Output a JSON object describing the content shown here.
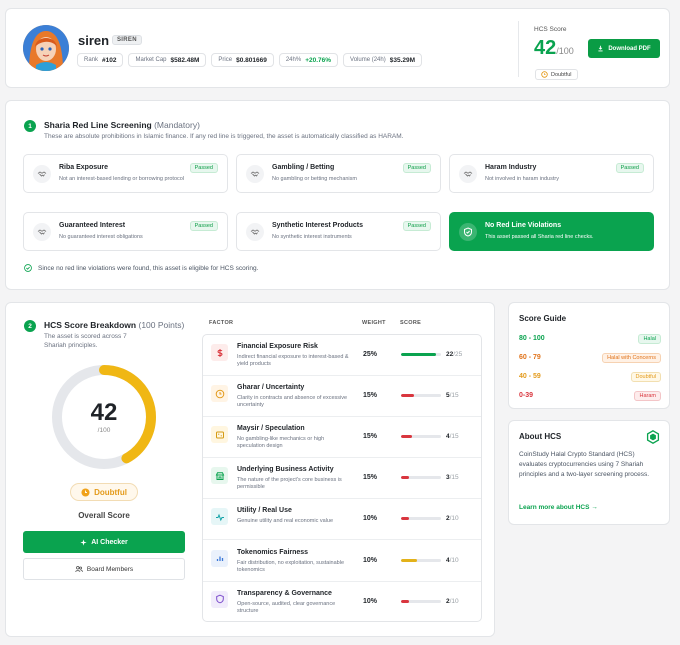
{
  "header": {
    "coin_name": "siren",
    "symbol": "SIREN",
    "stats": [
      {
        "label": "Rank",
        "value": "#102",
        "positive": false
      },
      {
        "label": "Market Cap",
        "value": "$582.48M",
        "positive": false
      },
      {
        "label": "Price",
        "value": "$0.801669",
        "positive": false
      },
      {
        "label": "24h%",
        "value": "+20.76%",
        "positive": true
      },
      {
        "label": "Volume (24h)",
        "value": "$35.29M",
        "positive": false
      }
    ],
    "hcs_label": "HCS Score",
    "hcs_score": "42",
    "hcs_max": "/100",
    "hcs_status": "Doubtful",
    "download_label": "Download PDF"
  },
  "red_line": {
    "number": "1",
    "title": "Sharia Red Line Screening",
    "title_suffix": "(Mandatory)",
    "subtitle": "These are absolute prohibitions in Islamic finance. If any red line is triggered, the asset is automatically classified as HARAM.",
    "items": [
      {
        "title": "Riba Exposure",
        "desc": "Not an interest-based lending or borrowing protocol",
        "status": "Passed"
      },
      {
        "title": "Gambling / Betting",
        "desc": "No gambling or betting mechanism",
        "status": "Passed"
      },
      {
        "title": "Haram Industry",
        "desc": "Not involved in haram industry",
        "status": "Passed"
      },
      {
        "title": "Guaranteed Interest",
        "desc": "No guaranteed interest obligations",
        "status": "Passed"
      },
      {
        "title": "Synthetic Interest Products",
        "desc": "No synthetic interest instruments",
        "status": "Passed"
      }
    ],
    "summary_title": "No Red Line Violations",
    "summary_desc": "This asset passed all Sharia red line checks.",
    "eligible_text": "Since no red line violations were found, this asset is eligible for HCS scoring."
  },
  "breakdown": {
    "number": "2",
    "title": "HCS Score Breakdown",
    "title_suffix": "(100 Points)",
    "subtitle": "The asset is scored across 7 Shariah principles.",
    "score": "42",
    "score_max": "/100",
    "score_fraction": 0.42,
    "status": "Doubtful",
    "overall_label": "Overall Score",
    "ai_label": "AI Checker",
    "board_label": "Board Members",
    "col_factor": "FACTOR",
    "col_weight": "WEIGHT",
    "col_score": "SCORE",
    "factors": [
      {
        "title": "Financial Exposure Risk",
        "desc": "Indirect financial exposure to interest-based & yield products",
        "weight": "25%",
        "score": "22",
        "max": "/25",
        "fraction": 0.88,
        "color": "#0aa34f",
        "icon": "dollar-icon",
        "icon_bg": "#fdeceb",
        "icon_fg": "#d9363e"
      },
      {
        "title": "Gharar / Uncertainty",
        "desc": "Clarity in contracts and absence of excessive uncertainty",
        "weight": "15%",
        "score": "5",
        "max": "/15",
        "fraction": 0.33,
        "color": "#d9363e",
        "icon": "clock-icon",
        "icon_bg": "#fff4e5",
        "icon_fg": "#e39a1a"
      },
      {
        "title": "Maysir / Speculation",
        "desc": "No gambling-like mechanics or high speculation design",
        "weight": "15%",
        "score": "4",
        "max": "/15",
        "fraction": 0.27,
        "color": "#d9363e",
        "icon": "dice-icon",
        "icon_bg": "#fff6e0",
        "icon_fg": "#d49a12"
      },
      {
        "title": "Underlying Business Activity",
        "desc": "The nature of the project's core business is permissible",
        "weight": "15%",
        "score": "3",
        "max": "/15",
        "fraction": 0.2,
        "color": "#d9363e",
        "icon": "store-icon",
        "icon_bg": "#e7f7ee",
        "icon_fg": "#0aa34f"
      },
      {
        "title": "Utility / Real Use",
        "desc": "Genuine utility and real economic value",
        "weight": "10%",
        "score": "2",
        "max": "/10",
        "fraction": 0.2,
        "color": "#d9363e",
        "icon": "pulse-icon",
        "icon_bg": "#e6f6f7",
        "icon_fg": "#13a3a8"
      },
      {
        "title": "Tokenomics Fairness",
        "desc": "Fair distribution, no exploitation, sustainable tokenomics",
        "weight": "10%",
        "score": "4",
        "max": "/10",
        "fraction": 0.4,
        "color": "#e3b21a",
        "icon": "chart-icon",
        "icon_bg": "#eaf1fc",
        "icon_fg": "#3b78d8"
      },
      {
        "title": "Transparency & Governance",
        "desc": "Open-source, audited, clear governance structure",
        "weight": "10%",
        "score": "2",
        "max": "/10",
        "fraction": 0.2,
        "color": "#d9363e",
        "icon": "shield-icon",
        "icon_bg": "#f1ecfb",
        "icon_fg": "#7c4dcc"
      }
    ]
  },
  "guide": {
    "title": "Score Guide",
    "rows": [
      {
        "range": "80 - 100",
        "label": "Halal",
        "color": "#0aa34f",
        "bg": "#e7f7ee",
        "border": "#c6ebd4"
      },
      {
        "range": "60 - 79",
        "label": "Halal with Concerns",
        "color": "#e0731b",
        "bg": "#fff1e5",
        "border": "#f6d2b2"
      },
      {
        "range": "40 - 59",
        "label": "Doubtful",
        "color": "#e39a1a",
        "bg": "#fff8e6",
        "border": "#f2dfb0"
      },
      {
        "range": "0-39",
        "label": "Haram",
        "color": "#d9363e",
        "bg": "#fdecec",
        "border": "#f3c5c7"
      }
    ]
  },
  "about": {
    "title": "About HCS",
    "text": "CoinStudy Halal Crypto Standard (HCS) evaluates cryptocurrencies using 7 Shariah principles and a two-layer screening process.",
    "link": "Learn more about HCS →"
  }
}
